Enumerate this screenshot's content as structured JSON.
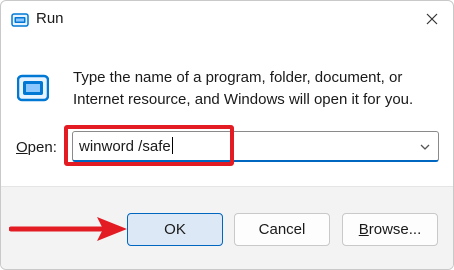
{
  "window": {
    "title": "Run",
    "icon": "run-app-icon",
    "close_icon": "close-icon"
  },
  "body": {
    "icon": "run-icon",
    "description": "Type the name of a program, folder, document, or Internet resource, and Windows will open it for you."
  },
  "open": {
    "label_prefix": "O",
    "label_rest": "pen:",
    "value": "winword /safe",
    "dropdown_icon": "chevron-down-icon"
  },
  "buttons": {
    "ok": "OK",
    "cancel": "Cancel",
    "browse_prefix": "B",
    "browse_rest": "rowse..."
  },
  "colors": {
    "accent": "#0067c0",
    "highlight_annotation": "#e31b23",
    "footer_bg": "#f3f3f3",
    "ok_bg": "#dce8f5"
  }
}
